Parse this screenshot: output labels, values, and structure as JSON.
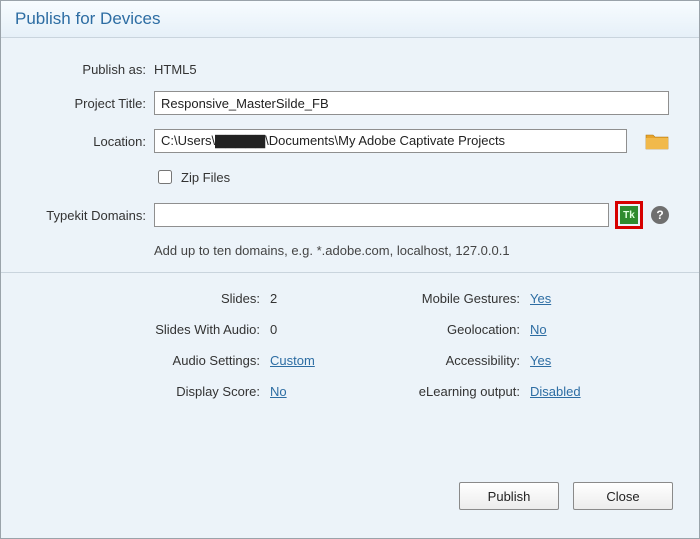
{
  "title": "Publish for Devices",
  "form": {
    "publish_as_label": "Publish as:",
    "publish_as_value": "HTML5",
    "project_title_label": "Project Title:",
    "project_title_value": "Responsive_MasterSilde_FB",
    "location_label": "Location:",
    "location_value": "C:\\Users\\▇▇▇▇▇\\Documents\\My Adobe Captivate Projects",
    "zip_label": "Zip Files",
    "typekit_label": "Typekit Domains:",
    "typekit_value": "",
    "typekit_badge": "Tk",
    "hint": "Add up to ten domains, e.g. *.adobe.com, localhost, 127.0.0.1"
  },
  "info": {
    "left": [
      {
        "label": "Slides:",
        "value": "2",
        "link": false
      },
      {
        "label": "Slides With Audio:",
        "value": "0",
        "link": false
      },
      {
        "label": "Audio Settings:",
        "value": "Custom",
        "link": true
      },
      {
        "label": "Display Score:",
        "value": "No",
        "link": true
      }
    ],
    "right": [
      {
        "label": "Mobile Gestures:",
        "value": "Yes",
        "link": true
      },
      {
        "label": "Geolocation:",
        "value": "No",
        "link": true
      },
      {
        "label": "Accessibility:",
        "value": "Yes",
        "link": true
      },
      {
        "label": "eLearning output:",
        "value": "Disabled",
        "link": true
      }
    ]
  },
  "buttons": {
    "publish": "Publish",
    "close": "Close"
  },
  "icons": {
    "help": "?"
  }
}
